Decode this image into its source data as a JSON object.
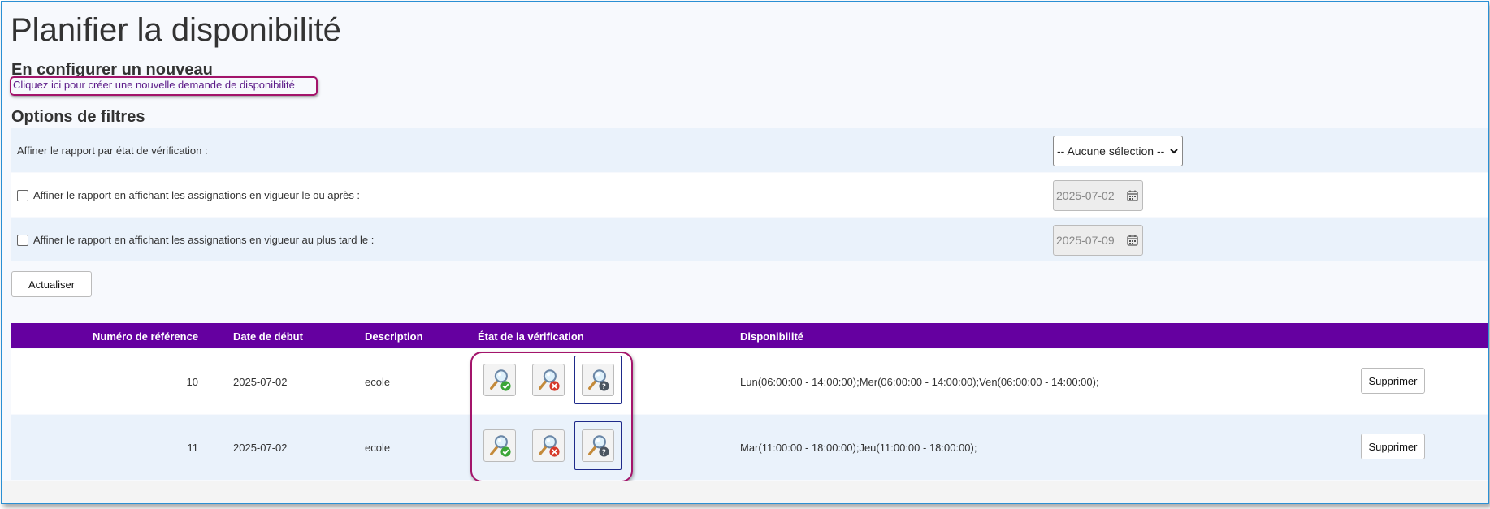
{
  "page": {
    "title": "Planifier la disponibilité",
    "new_section_title": "En configurer un nouveau",
    "new_link": "Cliquez ici pour créer une nouvelle demande de disponibilité",
    "filters_title": "Options de filtres"
  },
  "filters": {
    "status_label": "Affiner le rapport par état de vérification :",
    "status_select_value": "-- Aucune sélection --",
    "after_label": "Affiner le rapport en affichant les assignations en vigueur le ou après :",
    "after_checked": false,
    "after_date": "2025-07-02",
    "before_label": "Affiner le rapport en affichant les assignations en vigueur au plus tard le :",
    "before_checked": false,
    "before_date": "2025-07-09",
    "refresh_label": "Actualiser"
  },
  "table": {
    "columns": [
      "Numéro de référence",
      "Date de début",
      "Description",
      "État de la vérification",
      "Disponibilité"
    ],
    "rows": [
      {
        "ref": "10",
        "start": "2025-07-02",
        "description": "ecole",
        "availability": "Lun(06:00:00 - 14:00:00);Mer(06:00:00 - 14:00:00);Ven(06:00:00 - 14:00:00);",
        "delete_label": "Supprimer"
      },
      {
        "ref": "11",
        "start": "2025-07-02",
        "description": "ecole",
        "availability": "Mar(11:00:00 - 18:00:00);Jeu(11:00:00 - 18:00:00);",
        "delete_label": "Supprimer"
      }
    ]
  },
  "icons": {
    "approve": "magnifier-check-icon",
    "reject": "magnifier-x-icon",
    "pending": "magnifier-question-icon",
    "calendar": "calendar-icon"
  },
  "colors": {
    "header_bg": "#6500a0",
    "highlight": "#a3146b",
    "approve_green": "#3aa537",
    "reject_red": "#d63a2a",
    "pending_gray": "#4b5560"
  }
}
